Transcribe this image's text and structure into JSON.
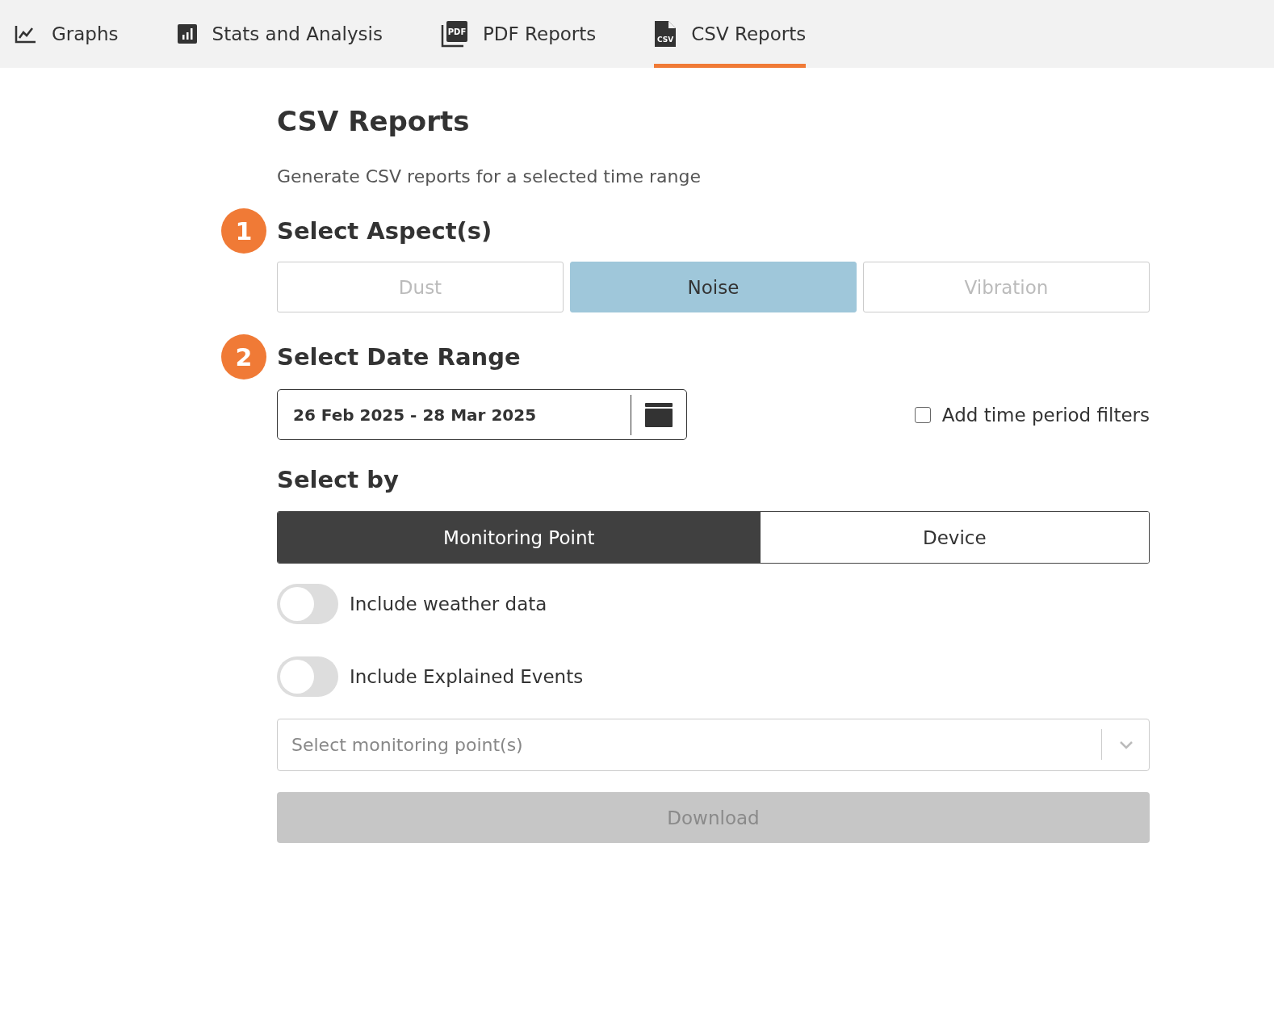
{
  "tabs": [
    {
      "label": "Graphs",
      "kind": "graph",
      "selected": false
    },
    {
      "label": "Stats and Analysis",
      "kind": "stats",
      "selected": false
    },
    {
      "label": "PDF Reports",
      "kind": "pdf",
      "icon_text": "PDF",
      "selected": false
    },
    {
      "label": "CSV Reports",
      "kind": "csv",
      "icon_text": "CSV",
      "selected": true
    }
  ],
  "page": {
    "title": "CSV Reports",
    "subtitle": "Generate CSV reports for a selected time range"
  },
  "step_1": {
    "number": "1",
    "heading": "Select Aspect(s)",
    "aspects": [
      {
        "label": "Dust",
        "selected": false
      },
      {
        "label": "Noise",
        "selected": true
      },
      {
        "label": "Vibration",
        "selected": false
      }
    ]
  },
  "step_2": {
    "number": "2",
    "heading": "Select Date Range",
    "date_range": "26 Feb 2025 - 28 Mar 2025",
    "time_filter": {
      "label": "Add time period filters",
      "checked": false
    }
  },
  "select_by": {
    "heading": "Select by",
    "options": [
      {
        "label": "Monitoring Point",
        "selected": true
      },
      {
        "label": "Device",
        "selected": false
      }
    ]
  },
  "toggles": [
    {
      "label": "Include weather data",
      "on": false
    },
    {
      "label": "Include Explained Events",
      "on": false
    }
  ],
  "monitoring_points": {
    "placeholder": "Select monitoring point(s)"
  },
  "download": {
    "label": "Download",
    "disabled": true
  }
}
